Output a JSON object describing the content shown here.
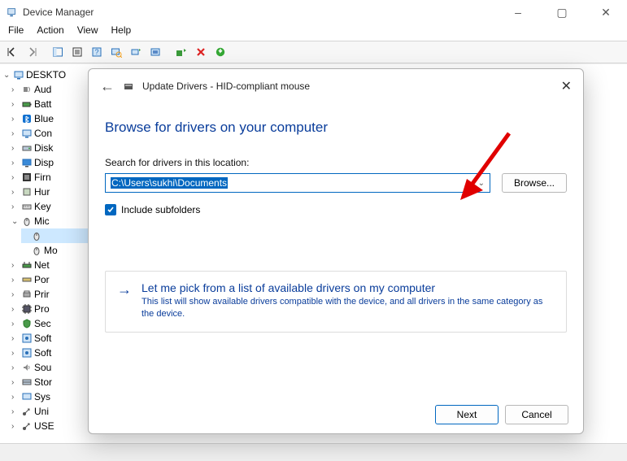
{
  "window": {
    "title": "Device Manager",
    "controls": {
      "min": "–",
      "max": "▢",
      "close": "✕"
    }
  },
  "menubar": [
    "File",
    "Action",
    "View",
    "Help"
  ],
  "tree": {
    "root": "DESKTO",
    "items": [
      {
        "label": "Aud",
        "icon": "audio"
      },
      {
        "label": "Batt",
        "icon": "battery"
      },
      {
        "label": "Blue",
        "icon": "bluetooth"
      },
      {
        "label": "Con",
        "icon": "computer"
      },
      {
        "label": "Disk",
        "icon": "disk"
      },
      {
        "label": "Disp",
        "icon": "display"
      },
      {
        "label": "Firn",
        "icon": "firmware"
      },
      {
        "label": "Hur",
        "icon": "hid"
      },
      {
        "label": "Key",
        "icon": "keyboard"
      },
      {
        "label": "Mic",
        "icon": "mouse",
        "expanded": true,
        "children": [
          {
            "label": "",
            "icon": "mouse",
            "selected": true
          },
          {
            "label": "Mo",
            "icon": "mouse"
          }
        ]
      },
      {
        "label": "Net",
        "icon": "network"
      },
      {
        "label": "Por",
        "icon": "ports"
      },
      {
        "label": "Prir",
        "icon": "printer"
      },
      {
        "label": "Pro",
        "icon": "processor"
      },
      {
        "label": "Sec",
        "icon": "security"
      },
      {
        "label": "Soft",
        "icon": "software"
      },
      {
        "label": "Soft",
        "icon": "software"
      },
      {
        "label": "Sou",
        "icon": "sound"
      },
      {
        "label": "Stor",
        "icon": "storage"
      },
      {
        "label": "Sys",
        "icon": "system"
      },
      {
        "label": "Uni",
        "icon": "usb"
      },
      {
        "label": "USE",
        "icon": "usb"
      }
    ]
  },
  "dialog": {
    "title": "Update Drivers - HID-compliant mouse",
    "heading": "Browse for drivers on your computer",
    "search_label": "Search for drivers in this location:",
    "path_value": "C:\\Users\\sukhi\\Documents",
    "browse_btn": "Browse...",
    "include_sub": "Include subfolders",
    "option": {
      "title": "Let me pick from a list of available drivers on my computer",
      "desc": "This list will show available drivers compatible with the device, and all drivers in the same category as the device."
    },
    "buttons": {
      "next": "Next",
      "cancel": "Cancel"
    }
  }
}
